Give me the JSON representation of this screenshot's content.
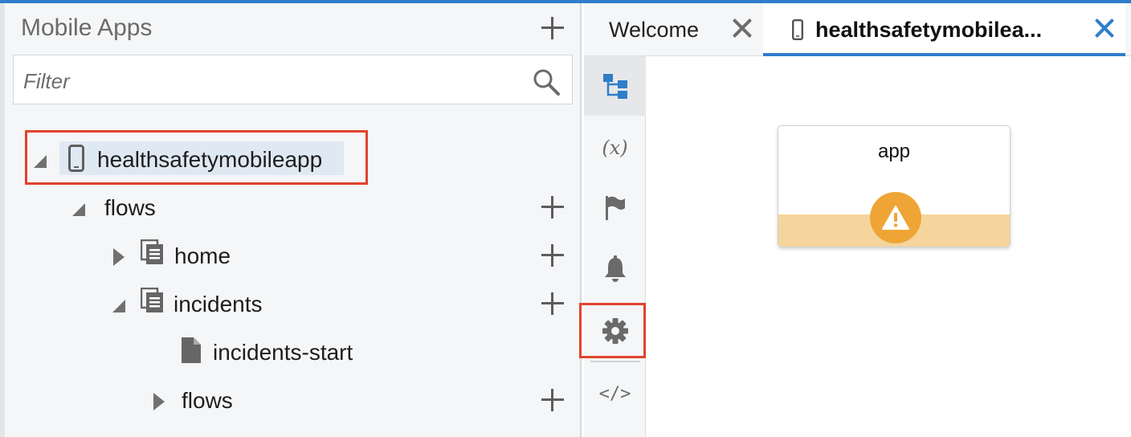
{
  "left_panel": {
    "title": "Mobile Apps",
    "filter_placeholder": "Filter",
    "tree": {
      "app": "healthsafetymobileapp",
      "flows": "flows",
      "home": "home",
      "incidents": "incidents",
      "incidents_start": "incidents-start",
      "sub_flows": "flows"
    }
  },
  "tabs": [
    {
      "label": "Welcome"
    },
    {
      "label": "healthsafetymobilea..."
    }
  ],
  "activity_bar": {
    "items": [
      "diagram-icon",
      "variables-icon",
      "flag-icon",
      "bell-icon",
      "gear-icon",
      "code-icon"
    ],
    "variables_glyph": "(x)",
    "code_glyph": "</>"
  },
  "canvas": {
    "node_title": "app",
    "node_status": "warning"
  },
  "colors": {
    "accent": "#2f7ec9",
    "highlight": "#e0432f",
    "warning": "#eea535",
    "warning_band": "#f5d59b"
  }
}
